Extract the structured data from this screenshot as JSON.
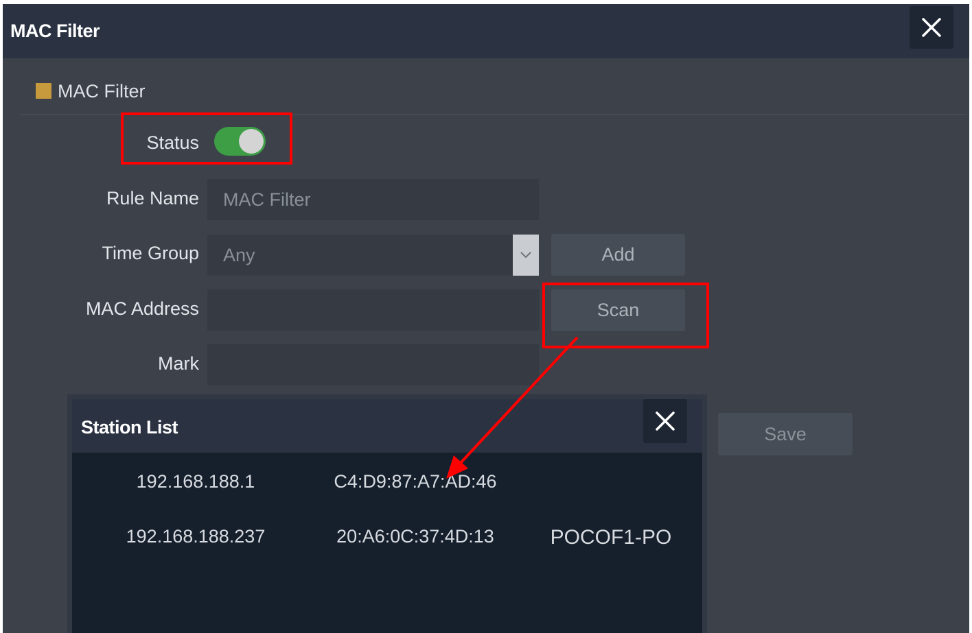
{
  "window": {
    "title": "MAC Filter"
  },
  "section": {
    "title": "MAC Filter"
  },
  "form": {
    "status_label": "Status",
    "status_on": true,
    "rule_name_label": "Rule Name",
    "rule_name_placeholder": "MAC Filter",
    "time_group_label": "Time Group",
    "time_group_value": "Any",
    "mac_address_label": "MAC Address",
    "mac_address_value": "",
    "mark_label": "Mark",
    "mark_value": "",
    "add_label": "Add",
    "scan_label": "Scan",
    "save_label": "Save"
  },
  "station_list": {
    "title": "Station List",
    "rows": [
      {
        "ip": "192.168.188.1",
        "mac": "C4:D9:87:A7:AD:46",
        "name": ""
      },
      {
        "ip": "192.168.188.237",
        "mac": "20:A6:0C:37:4D:13",
        "name": "POCOF1-PO"
      }
    ]
  },
  "colors": {
    "accent": "#c79a3e",
    "toggle_on": "#3d9e46",
    "highlight": "#ff0000"
  }
}
